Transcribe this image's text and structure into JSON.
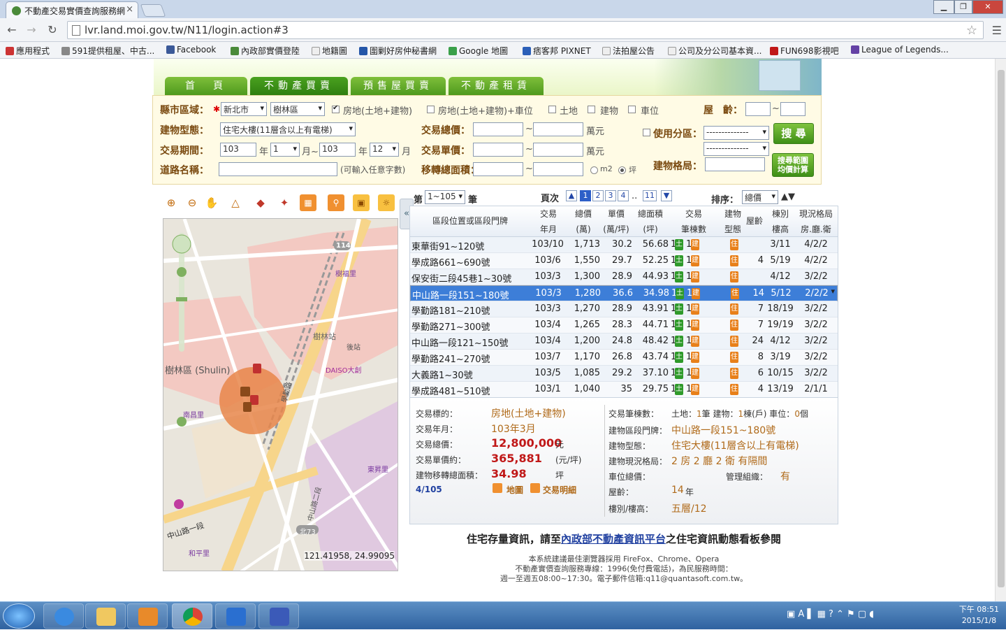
{
  "browser": {
    "tab_title": "不動產交易實價查詢服務網",
    "url": "lvr.land.moi.gov.tw/N11/login.action#3",
    "bookmarks": [
      "應用程式",
      "591提供租屋、中古...",
      "Facebook",
      "內政部實價登陸",
      "地籍圖",
      "圍剿好房仲秘書網",
      "Google 地圖",
      "痞客邦 PIXNET",
      "法拍屋公告",
      "公司及分公司基本資...",
      "FUN698影視吧",
      "League of Legends..."
    ]
  },
  "nav_tabs": [
    "首　頁",
    "不動產買賣",
    "預售屋買賣",
    "不動產租賃"
  ],
  "form": {
    "county_label": "縣市區域：",
    "county": "新北市",
    "district": "樹林區",
    "check_options": [
      "房地(土地+建物)",
      "房地(土地+建物)+車位",
      "土地",
      "建物",
      "車位"
    ],
    "age_label": "屋　齡：",
    "building_type_label": "建物型態：",
    "building_type": "住宅大樓(11層含以上有電梯)",
    "total_price_label": "交易總價：",
    "unit_wan": "萬元",
    "zoning_label": "使用分區：",
    "zoning_value": "--------------",
    "search_btn": "搜 尋",
    "period_label": "交易期間：",
    "year_from": "103",
    "month_from": "1",
    "year_to": "103",
    "month_to": "12",
    "year_suffix": "年",
    "month_suffix": "月",
    "month_to_suffix": "月~",
    "unit_price_label": "交易單價：",
    "zoning_value2": "--------------",
    "road_label": "道路名稱：",
    "road_hint": "(可輸入任意字數)",
    "area_label": "移轉總面積：",
    "unit_m2": "m2",
    "unit_ping": "坪",
    "layout_label": "建物格局：",
    "calc_btn": [
      "搜尋範圍",
      "均價計算"
    ],
    "tilde": "~"
  },
  "list": {
    "prefix": "第",
    "range": "1~105",
    "suffix": "筆",
    "page_label": "頁次",
    "pages": [
      "1",
      "2",
      "3",
      "4",
      "11"
    ],
    "ellipsis": "..",
    "sort_label": "排序：",
    "sort_value": "總價",
    "sort_arrows": "▲▼"
  },
  "table": {
    "headers": {
      "addr": "區段位置或區段門牌",
      "date": [
        "交易",
        "年月"
      ],
      "total": [
        "總價",
        "(萬)"
      ],
      "unit": [
        "單價",
        "(萬/坪)"
      ],
      "area": [
        "總面積",
        "(坪)"
      ],
      "count": [
        "交易",
        "筆棟數"
      ],
      "type": [
        "建物",
        "型態"
      ],
      "age": "屋齡",
      "floor": [
        "棟別",
        "樓高"
      ],
      "layout": [
        "現況格局",
        "房.廳.衛"
      ]
    },
    "land_badge": "土",
    "bld_badge": "建",
    "type_badge": "住",
    "count_num": "1",
    "rows": [
      {
        "addr": "東華街91~120號",
        "date": "103/10",
        "total": "1,713",
        "unit": "30.2",
        "area": "56.68",
        "age": "",
        "floor": "3/11",
        "layout": "4/2/2"
      },
      {
        "addr": "學成路661~690號",
        "date": "103/6",
        "total": "1,550",
        "unit": "29.7",
        "area": "52.25",
        "age": "4",
        "floor": "5/19",
        "layout": "4/2/2"
      },
      {
        "addr": "保安街二段45巷1~30號",
        "date": "103/3",
        "total": "1,300",
        "unit": "28.9",
        "area": "44.93",
        "age": "",
        "floor": "4/12",
        "layout": "3/2/2"
      },
      {
        "addr": "中山路一段151~180號",
        "date": "103/3",
        "total": "1,280",
        "unit": "36.6",
        "area": "34.98",
        "age": "14",
        "floor": "5/12",
        "layout": "2/2/2"
      },
      {
        "addr": "學勤路181~210號",
        "date": "103/3",
        "total": "1,270",
        "unit": "28.9",
        "area": "43.91",
        "age": "7",
        "floor": "18/19",
        "layout": "3/2/2"
      },
      {
        "addr": "學勤路271~300號",
        "date": "103/4",
        "total": "1,265",
        "unit": "28.3",
        "area": "44.71",
        "age": "7",
        "floor": "19/19",
        "layout": "3/2/2"
      },
      {
        "addr": "中山路一段121~150號",
        "date": "103/4",
        "total": "1,200",
        "unit": "24.8",
        "area": "48.42",
        "age": "24",
        "floor": "4/12",
        "layout": "3/2/2"
      },
      {
        "addr": "學勤路241~270號",
        "date": "103/7",
        "total": "1,170",
        "unit": "26.8",
        "area": "43.74",
        "age": "8",
        "floor": "3/19",
        "layout": "3/2/2"
      },
      {
        "addr": "大義路1~30號",
        "date": "103/5",
        "total": "1,085",
        "unit": "29.2",
        "area": "37.10",
        "age": "6",
        "floor": "10/15",
        "layout": "3/2/2"
      },
      {
        "addr": "學成路481~510號",
        "date": "103/1",
        "total": "1,040",
        "unit": "35",
        "area": "29.75",
        "age": "4",
        "floor": "13/19",
        "layout": "2/1/1"
      }
    ]
  },
  "detail": {
    "target_label": "交易標的：",
    "target": "房地(土地+建物)",
    "ym_label": "交易年月：",
    "ym": "103年3月",
    "total_label": "交易總價：",
    "total": "12,800,000",
    "total_unit": "元",
    "unit_label": "交易單價約：",
    "unit": "365,881",
    "unit_unit": "(元/坪)",
    "area_label": "建物移轉總面積：",
    "area": "34.98",
    "area_unit": "坪",
    "index": "4/105",
    "map_link": "地圖",
    "detail_link": "交易明細",
    "count_label": "交易筆棟數：",
    "count_land": "土地：",
    "count_land_n": "1",
    "count_land_u": "筆 建物：",
    "count_bld_n": "1",
    "count_bld_u": "棟(戶) 車位：",
    "count_park_n": "0",
    "count_park_u": "個",
    "addr_label": "建物區段門牌：",
    "addr": "中山路一段151~180號",
    "btype_label": "建物型態：",
    "btype": "住宅大樓(11層含以上有電梯)",
    "layout_label": "建物現況格局：",
    "layout": "2 房 2 廳 2 衛 有隔間",
    "park_label": "車位總價：",
    "mgmt_label": "管理組織：",
    "mgmt": "有",
    "age_label": "屋齡：",
    "age": "14",
    "age_unit": "年",
    "floor_label": "樓別/樓高：",
    "floor": "五層/12"
  },
  "notice": {
    "pre": "住宅存量資訊，請至",
    "link": "內政部不動產資訊平台",
    "post": "之住宅資訊動態看板參閱"
  },
  "footer": [
    "本系統建議最佳瀏覽器採用 FireFox、Chrome、Opera",
    "不動產實價查詢服務專線：1996(免付費電話)，為民服務時間：",
    "週一至週五08:00~17:30。電子郵件信箱:q11@quantasoft.com.tw。"
  ],
  "map": {
    "coords": "121.41958, 24.99095",
    "district_label": "樹林區 (Shulin)",
    "road_labels": [
      "中山路一段",
      "樹林站",
      "DAISO大創",
      "樹福里",
      "學勤路",
      "後站",
      "中山路二段",
      "和平里",
      "南昌里",
      "東昇里"
    ],
    "route_sign": "114",
    "route_sign2": "北73"
  },
  "taskbar": {
    "time": "下午 08:51",
    "date": "2015/1/8"
  }
}
